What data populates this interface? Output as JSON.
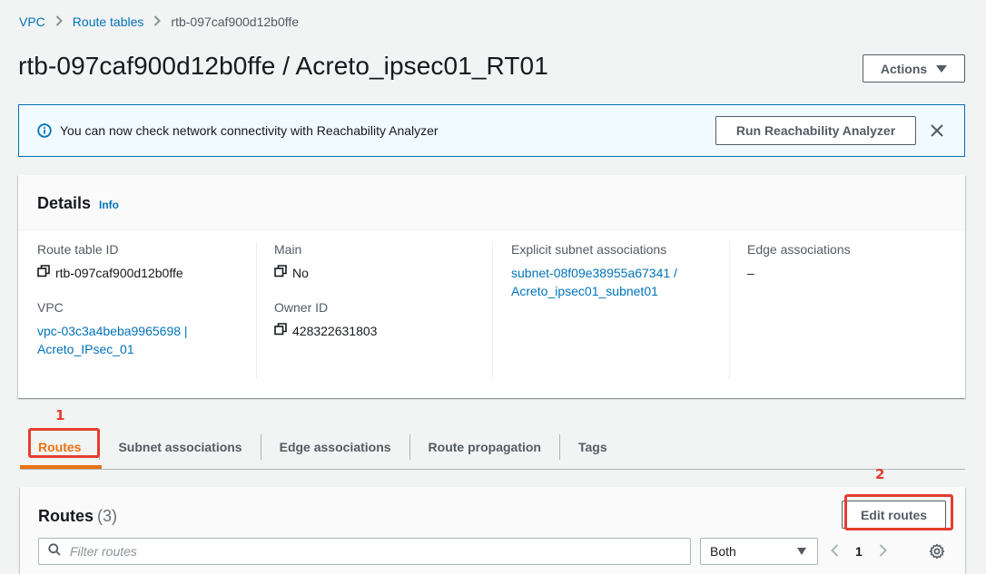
{
  "breadcrumb": {
    "items": [
      "VPC",
      "Route tables"
    ],
    "current": "rtb-097caf900d12b0ffe"
  },
  "header": {
    "title": "rtb-097caf900d12b0ffe / Acreto_ipsec01_RT01",
    "actions_label": "Actions"
  },
  "flash": {
    "message": "You can now check network connectivity with Reachability Analyzer",
    "button_label": "Run Reachability Analyzer",
    "icon": "info-icon"
  },
  "details": {
    "title": "Details",
    "info_label": "Info",
    "route_table_id": {
      "label": "Route table ID",
      "value": "rtb-097caf900d12b0ffe"
    },
    "vpc": {
      "label": "VPC",
      "value_line1": "vpc-03c3a4beba9965698 |",
      "value_line2": "Acreto_IPsec_01"
    },
    "main": {
      "label": "Main",
      "value": "No"
    },
    "owner_id": {
      "label": "Owner ID",
      "value": "428322631803"
    },
    "explicit_subnet": {
      "label": "Explicit subnet associations",
      "value_line1": "subnet-08f09e38955a67341 /",
      "value_line2": "Acreto_ipsec01_subnet01"
    },
    "edge": {
      "label": "Edge associations",
      "value": "–"
    }
  },
  "tabs": [
    "Routes",
    "Subnet associations",
    "Edge associations",
    "Route propagation",
    "Tags"
  ],
  "annotations": [
    "1",
    "2"
  ],
  "routes": {
    "title": "Routes",
    "count": "(3)",
    "edit_label": "Edit routes",
    "filter_placeholder": "Filter routes",
    "select_value": "Both",
    "page": "1"
  },
  "colors": {
    "accent": "#ec7211",
    "link": "#0073bb",
    "annotation": "#e53d2e"
  }
}
